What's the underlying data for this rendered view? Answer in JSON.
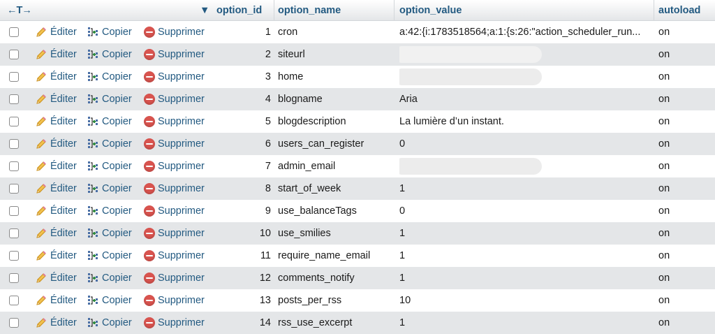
{
  "header": {
    "arrows": "←T→",
    "sort_indicator": "▼",
    "columns": {
      "option_id": "option_id",
      "option_name": "option_name",
      "option_value": "option_value",
      "autoload": "autoload"
    }
  },
  "actions": {
    "edit": "Éditer",
    "copy": "Copier",
    "delete": "Supprimer"
  },
  "icons": {
    "edit": "pencil-icon",
    "copy": "copy-icon",
    "delete": "delete-icon"
  },
  "rows": [
    {
      "id": "1",
      "name": "cron",
      "value": "a:42:{i:1783518564;a:1:{s:26:\"action_scheduler_run...",
      "redacted": false,
      "autoload": "on"
    },
    {
      "id": "2",
      "name": "siteurl",
      "value": "",
      "redacted": true,
      "autoload": "on"
    },
    {
      "id": "3",
      "name": "home",
      "value": "",
      "redacted": true,
      "autoload": "on"
    },
    {
      "id": "4",
      "name": "blogname",
      "value": "Aria",
      "redacted": false,
      "autoload": "on"
    },
    {
      "id": "5",
      "name": "blogdescription",
      "value": "La lumière d’un instant.",
      "redacted": false,
      "autoload": "on"
    },
    {
      "id": "6",
      "name": "users_can_register",
      "value": "0",
      "redacted": false,
      "autoload": "on"
    },
    {
      "id": "7",
      "name": "admin_email",
      "value": "",
      "redacted": true,
      "autoload": "on"
    },
    {
      "id": "8",
      "name": "start_of_week",
      "value": "1",
      "redacted": false,
      "autoload": "on"
    },
    {
      "id": "9",
      "name": "use_balanceTags",
      "value": "0",
      "redacted": false,
      "autoload": "on"
    },
    {
      "id": "10",
      "name": "use_smilies",
      "value": "1",
      "redacted": false,
      "autoload": "on"
    },
    {
      "id": "11",
      "name": "require_name_email",
      "value": "1",
      "redacted": false,
      "autoload": "on"
    },
    {
      "id": "12",
      "name": "comments_notify",
      "value": "1",
      "redacted": false,
      "autoload": "on"
    },
    {
      "id": "13",
      "name": "posts_per_rss",
      "value": "10",
      "redacted": false,
      "autoload": "on"
    },
    {
      "id": "14",
      "name": "rss_use_excerpt",
      "value": "1",
      "redacted": false,
      "autoload": "on"
    }
  ]
}
